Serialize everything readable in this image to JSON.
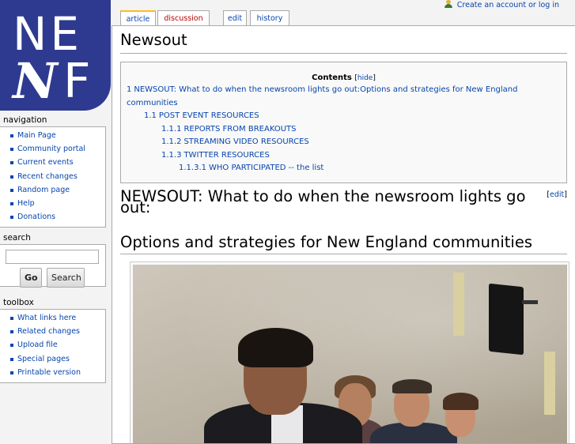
{
  "logo": {
    "line1": "NE",
    "line2a": "N",
    "line2b": "F"
  },
  "personal": {
    "create_account": "Create an account or log in"
  },
  "tabs": {
    "article": "article",
    "discussion": "discussion",
    "edit": "edit",
    "history": "history"
  },
  "navigation": {
    "title": "navigation",
    "items": [
      "Main Page",
      "Community portal",
      "Current events",
      "Recent changes",
      "Random page",
      "Help",
      "Donations"
    ]
  },
  "search": {
    "title": "search",
    "value": "",
    "go": "Go",
    "search": "Search"
  },
  "toolbox": {
    "title": "toolbox",
    "items": [
      "What links here",
      "Related changes",
      "Upload file",
      "Special pages",
      "Printable version"
    ]
  },
  "page": {
    "title": "Newsout",
    "toc": {
      "title": "Contents",
      "hide": "hide",
      "entries": [
        {
          "num": "1",
          "text": "NEWSOUT: What to do when the newsroom lights go out:Options and strategies for New England communities"
        },
        {
          "num": "1.1",
          "text": "POST EVENT RESOURCES"
        },
        {
          "num": "1.1.1",
          "text": "REPORTS FROM BREAKOUTS"
        },
        {
          "num": "1.1.2",
          "text": "STREAMING VIDEO RESOURCES"
        },
        {
          "num": "1.1.3",
          "text": "TWITTER RESOURCES"
        },
        {
          "num": "1.1.3.1",
          "text": "WHO PARTICIPATED -- the list"
        }
      ]
    },
    "section_heading": "NEWSOUT: What to do when the newsroom lights go out:",
    "edit_link": "edit",
    "subheading": "Options and strategies for New England communities"
  }
}
